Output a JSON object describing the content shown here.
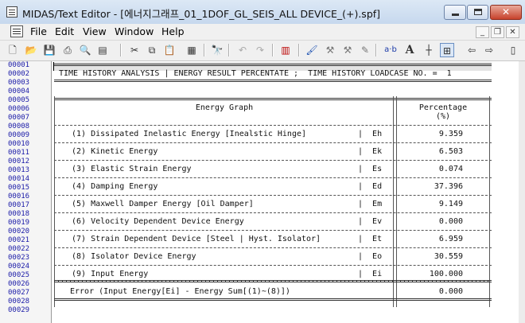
{
  "window": {
    "title": "MIDAS/Text Editor - [에너지그래프_01_1DOF_GL_SEIS_ALL DEVICE_(+).spf]",
    "close_label": "✕"
  },
  "menu": {
    "items": [
      "File",
      "Edit",
      "View",
      "Window",
      "Help"
    ]
  },
  "toolbar": {
    "icons": [
      "new-file-icon",
      "open-folder-icon",
      "save-icon",
      "print-icon",
      "print-preview-icon",
      "page-setup-icon",
      "cut-icon",
      "copy-icon",
      "paste-icon",
      "properties-icon",
      "find-icon",
      "undo-icon",
      "redo-icon",
      "bookmark-icon",
      "brush-icon",
      "format-icon",
      "format-clear-icon",
      "case-icon",
      "font-icon",
      "column-marker-icon",
      "wrap-icon",
      "nav-back-icon",
      "nav-forward-icon",
      "panel-icon"
    ],
    "case_label": "a·b",
    "font_label": "A"
  },
  "editor": {
    "line_numbers": [
      "00001",
      "00002",
      "00003",
      "00004",
      "00005",
      "00006",
      "00007",
      "00008",
      "00009",
      "00010",
      "00011",
      "00012",
      "00013",
      "00014",
      "00015",
      "00016",
      "00017",
      "00018",
      "00019",
      "00020",
      "00021",
      "00022",
      "00023",
      "00024",
      "00025",
      "00026",
      "00027",
      "00028",
      "00029"
    ],
    "header_text": "TIME HISTORY ANALYSIS | ENERGY RESULT PERCENTATE ;  TIME HISTORY LOADCASE NO. =  1",
    "table": {
      "col_label": "Energy Graph",
      "col_value": "Percentage",
      "col_unit": "(%)",
      "rows": [
        {
          "label": "(1) Dissipated Inelastic Energy [Inealstic Hinge]",
          "symbol": "Eh",
          "value": "9.359"
        },
        {
          "label": "(2) Kinetic Energy",
          "symbol": "Ek",
          "value": "6.503"
        },
        {
          "label": "(3) Elastic Strain Energy",
          "symbol": "Es",
          "value": "0.074"
        },
        {
          "label": "(4) Damping Energy",
          "symbol": "Ed",
          "value": "37.396"
        },
        {
          "label": "(5) Maxwell Damper Energy [Oil Damper]",
          "symbol": "Em",
          "value": "9.149"
        },
        {
          "label": "(6) Velocity Dependent Device Energy",
          "symbol": "Ev",
          "value": "0.000"
        },
        {
          "label": "(7) Strain Dependent Device [Steel | Hyst. Isolator]",
          "symbol": "Et",
          "value": "6.959"
        },
        {
          "label": "(8) Isolator Device Energy",
          "symbol": "Eo",
          "value": "30.559"
        },
        {
          "label": "(9) Input Energy",
          "symbol": "Ei",
          "value": "100.000"
        }
      ],
      "error_label": "Error (Input Energy[Ei] - Energy Sum[(1)~(8)])",
      "error_value": "0.000"
    }
  }
}
